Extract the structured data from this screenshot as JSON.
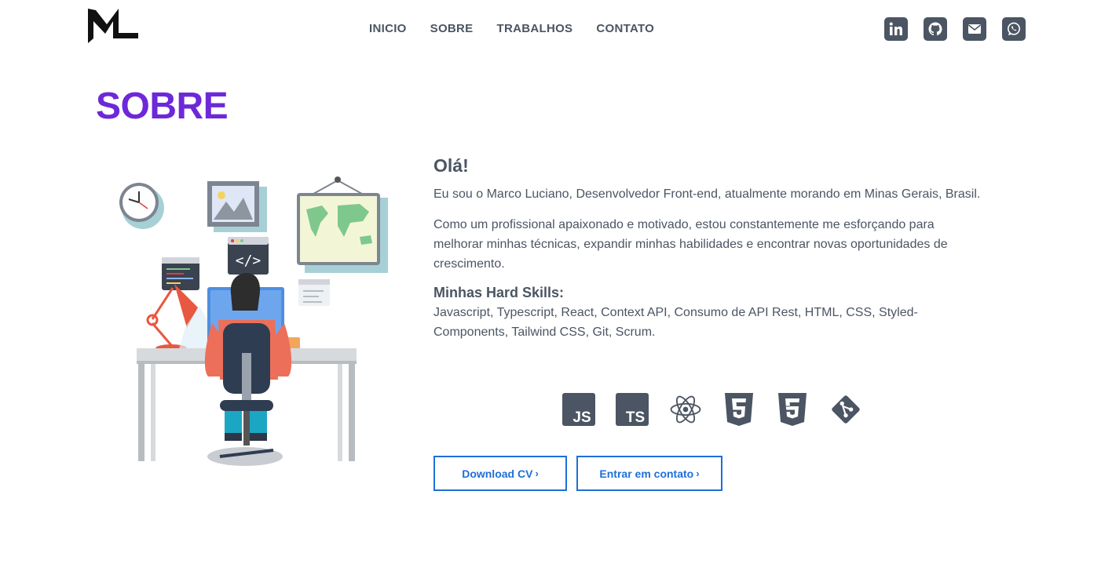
{
  "nav": {
    "items": [
      "INICIO",
      "SOBRE",
      "TRABALHOS",
      "CONTATO"
    ]
  },
  "socials": [
    {
      "icon": "linkedin-icon"
    },
    {
      "icon": "github-icon"
    },
    {
      "icon": "email-icon"
    },
    {
      "icon": "whatsapp-icon"
    }
  ],
  "section": {
    "title": "SOBRE"
  },
  "about": {
    "greeting": "Olá!",
    "intro": "Eu sou o Marco Luciano, Desenvolvedor Front-end, atualmente morando em Minas Gerais, Brasil.",
    "motivation": "Como um profissional apaixonado e motivado, estou constantemente me esforçando para melhorar minhas técnicas, expandir minhas habilidades e encontrar novas oportunidades de crescimento.",
    "skills_title": "Minhas Hard Skills:",
    "skills_text": "Javascript, Typescript, React, Context API, Consumo de API Rest, HTML, CSS, Styled-Components, Tailwind CSS, Git, Scrum.",
    "tech_icons": {
      "js": "JS",
      "ts": "TS"
    }
  },
  "buttons": {
    "download_cv": "Download CV",
    "contact": "Entrar em contato",
    "chevron": "›"
  },
  "colors": {
    "accent": "#6d28d9",
    "button": "#1e6fd9",
    "icon": "#4b5563"
  }
}
